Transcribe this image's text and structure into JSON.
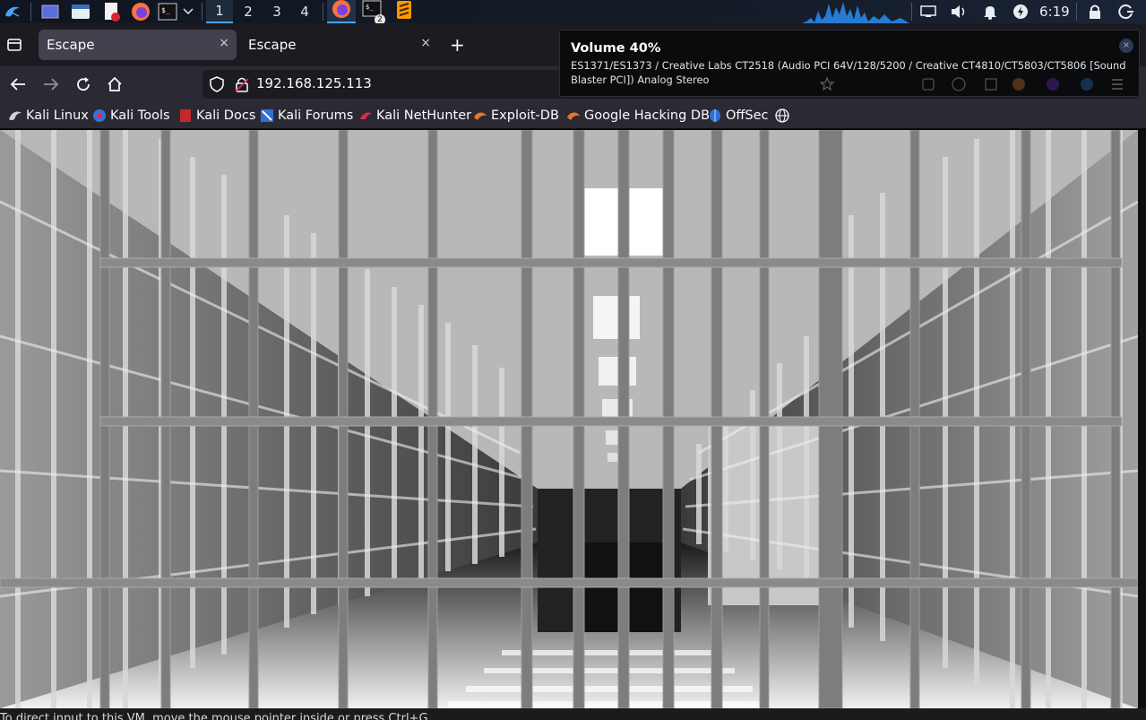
{
  "panel": {
    "workspaces": [
      "1",
      "2",
      "3",
      "4"
    ],
    "active_workspace": "1",
    "terminal_badge": "2",
    "clock": "6:19"
  },
  "browser": {
    "tabs": [
      {
        "title": "Escape",
        "close": "×"
      },
      {
        "title": "Escape",
        "close": "×"
      }
    ],
    "new_tab_label": "+",
    "url": "192.168.125.113",
    "bookmarks": [
      {
        "label": "Kali Linux",
        "icon": "kali-dragon-icon"
      },
      {
        "label": "Kali Tools",
        "icon": "kali-tools-icon"
      },
      {
        "label": "Kali Docs",
        "icon": "kali-docs-icon"
      },
      {
        "label": "Kali Forums",
        "icon": "kali-forums-icon"
      },
      {
        "label": "Kali NetHunter",
        "icon": "kali-nethunter-icon"
      },
      {
        "label": "Exploit-DB",
        "icon": "exploit-db-icon"
      },
      {
        "label": "Google Hacking DB",
        "icon": "exploit-db-icon"
      },
      {
        "label": "OffSec",
        "icon": "offsec-icon"
      }
    ]
  },
  "notification": {
    "title": "Volume 40%",
    "body": "ES1371/ES1373 / Creative Labs CT2518 (Audio PCI 64V/128/5200 / Creative CT4810/CT5803/CT5806 [Sound Blaster PCI]) Analog Stereo",
    "volume_percent": 40
  },
  "page": {
    "image_description_icon": "prison-bars-image"
  },
  "bottom": {
    "text": "To direct input to this VM, move the mouse pointer inside or press Ctrl+G."
  },
  "colors": {
    "accent": "#4aa3ff",
    "tab_bar": "#1c1b22",
    "nav_bar": "#2b2a33"
  }
}
